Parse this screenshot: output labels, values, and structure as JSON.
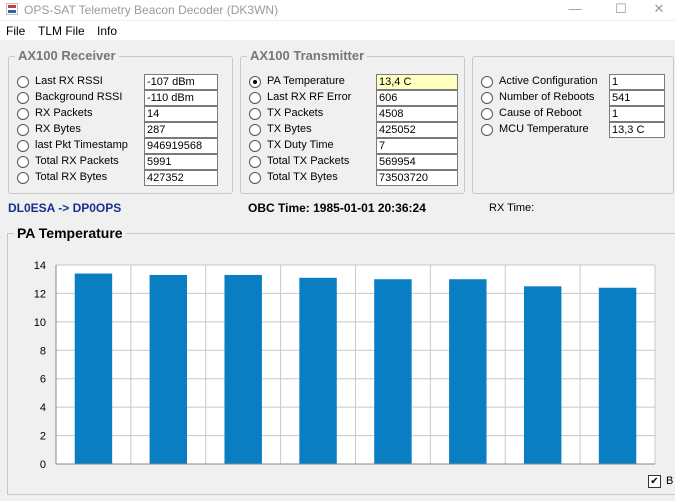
{
  "window": {
    "title": "OPS-SAT Telemetry Beacon Decoder (DK3WN)",
    "min_glyph": "—",
    "max_glyph": "☐",
    "close_glyph": "✕"
  },
  "menu": [
    "File",
    "TLM File",
    "Info"
  ],
  "receiver": {
    "title": "AX100 Receiver",
    "rows": [
      {
        "label": "Last RX RSSI",
        "value": "-107 dBm",
        "selected": false
      },
      {
        "label": "Background RSSI",
        "value": "-110 dBm",
        "selected": false
      },
      {
        "label": "RX Packets",
        "value": "14",
        "selected": false
      },
      {
        "label": "RX Bytes",
        "value": "287",
        "selected": false
      },
      {
        "label": "last Pkt Timestamp",
        "value": "946919568",
        "selected": false
      },
      {
        "label": "Total RX Packets",
        "value": "5991",
        "selected": false
      },
      {
        "label": "Total RX Bytes",
        "value": "427352",
        "selected": false
      }
    ]
  },
  "transmitter": {
    "title": "AX100 Transmitter",
    "rows": [
      {
        "label": "PA Temperature",
        "value": "13,4 C",
        "selected": true
      },
      {
        "label": "Last RX RF Error",
        "value": "606",
        "selected": false
      },
      {
        "label": "TX Packets",
        "value": "4508",
        "selected": false
      },
      {
        "label": "TX Bytes",
        "value": "425052",
        "selected": false
      },
      {
        "label": "TX Duty Time",
        "value": "7",
        "selected": false
      },
      {
        "label": "Total TX Packets",
        "value": "569954",
        "selected": false
      },
      {
        "label": "Total TX Bytes",
        "value": "73503720",
        "selected": false
      }
    ]
  },
  "system": {
    "rows": [
      {
        "label": "Active Configuration",
        "value": "1",
        "selected": false
      },
      {
        "label": "Number of Reboots",
        "value": "541",
        "selected": false
      },
      {
        "label": "Cause of Reboot",
        "value": "1",
        "selected": false
      },
      {
        "label": "MCU Temperature",
        "value": "13,3 C",
        "selected": false
      }
    ]
  },
  "status": {
    "callsigns": "DL0ESA -> DP0OPS",
    "obc_time": "OBC Time: 1985-01-01 20:36:24",
    "rx_time": "RX Time:"
  },
  "chart_data": {
    "type": "bar",
    "title": "PA Temperature",
    "categories": [
      "",
      "",
      "",
      "",
      "",
      "",
      "",
      ""
    ],
    "values": [
      13.4,
      13.3,
      13.3,
      13.1,
      13.0,
      13.0,
      12.5,
      12.4
    ],
    "ylim": [
      0,
      14
    ],
    "yticks": [
      0,
      2,
      4,
      6,
      8,
      10,
      12,
      14
    ],
    "grid": true,
    "bar_color": "#0a7ec2",
    "xlabel": "",
    "ylabel": ""
  },
  "autoscale_checkbox": {
    "label": "B",
    "checked": true,
    "glyph": "✔"
  }
}
